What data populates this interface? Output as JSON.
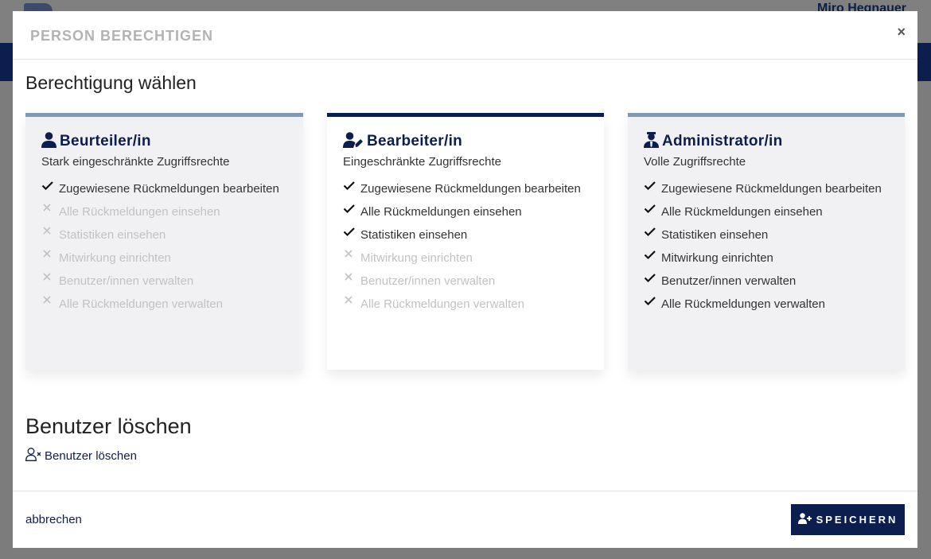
{
  "background": {
    "user_name": "Miro Hegnauer"
  },
  "modal": {
    "title": "PERSON BERECHTIGEN",
    "close_label": "×",
    "section_title": "Berechtigung wählen",
    "roles": [
      {
        "name": "Beurteiler/in",
        "icon": "user-icon",
        "subtitle": "Stark eingeschränkte Zugriffsrechte",
        "selected": false,
        "permissions": [
          {
            "label": "Zugewiesene Rückmeldungen bearbeiten",
            "allowed": true
          },
          {
            "label": "Alle Rückmeldungen einsehen",
            "allowed": false
          },
          {
            "label": "Statistiken einsehen",
            "allowed": false
          },
          {
            "label": "Mitwirkung einrichten",
            "allowed": false
          },
          {
            "label": "Benutzer/innen verwalten",
            "allowed": false
          },
          {
            "label": "Alle Rückmeldungen verwalten",
            "allowed": false
          }
        ]
      },
      {
        "name": "Bearbeiter/in",
        "icon": "user-edit-icon",
        "subtitle": "Eingeschränkte Zugriffsrechte",
        "selected": true,
        "permissions": [
          {
            "label": "Zugewiesene Rückmeldungen bearbeiten",
            "allowed": true
          },
          {
            "label": "Alle Rückmeldungen einsehen",
            "allowed": true
          },
          {
            "label": "Statistiken einsehen",
            "allowed": true
          },
          {
            "label": "Mitwirkung einrichten",
            "allowed": false
          },
          {
            "label": "Benutzer/innen verwalten",
            "allowed": false
          },
          {
            "label": "Alle Rückmeldungen verwalten",
            "allowed": false
          }
        ]
      },
      {
        "name": "Administrator/in",
        "icon": "user-tie-icon",
        "subtitle": "Volle Zugriffsrechte",
        "selected": false,
        "permissions": [
          {
            "label": "Zugewiesene Rückmeldungen bearbeiten",
            "allowed": true
          },
          {
            "label": "Alle Rückmeldungen einsehen",
            "allowed": true
          },
          {
            "label": "Statistiken einsehen",
            "allowed": true
          },
          {
            "label": "Mitwirkung einrichten",
            "allowed": true
          },
          {
            "label": "Benutzer/innen verwalten",
            "allowed": true
          },
          {
            "label": "Alle Rückmeldungen verwalten",
            "allowed": true
          }
        ]
      }
    ],
    "delete_section_title": "Benutzer löschen",
    "delete_link_label": "Benutzer löschen",
    "cancel_label": "abbrechen",
    "save_label": "SPEICHERN"
  },
  "colors": {
    "primary": "#0b1e4e",
    "card_border_inactive": "#8199b0",
    "disabled_text": "#c2c2c2"
  }
}
